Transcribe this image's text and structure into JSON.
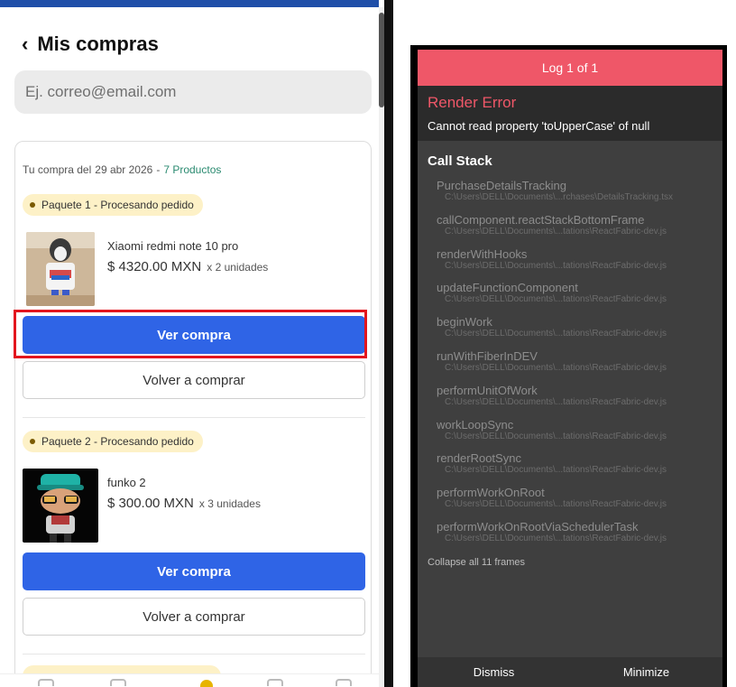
{
  "app": {
    "title": "Mis compras",
    "search_placeholder": "Ej. correo@email.com",
    "purchase": {
      "prefix": "Tu compra del",
      "date": "29 abr 2026",
      "sep": "-",
      "count": "7 Productos"
    },
    "packages": [
      {
        "badge": "Paquete 1 - Procesando pedido",
        "product_name": "Xiaomi redmi note 10 pro",
        "price": "$ 4320.00 MXN",
        "qty": "x 2 unidades",
        "btn_primary": "Ver compra",
        "btn_secondary": "Volver a comprar"
      },
      {
        "badge": "Paquete 2 - Procesando pedido",
        "product_name": "funko 2",
        "price": "$ 300.00 MXN",
        "qty": "x 3 unidades",
        "btn_primary": "Ver compra",
        "btn_secondary": "Volver a comprar"
      }
    ],
    "colors": {
      "primary": "#2f64e6",
      "badge_bg": "#fdf1c7",
      "highlight": "#e3161e",
      "count": "#2a8a70"
    }
  },
  "log": {
    "header": "Log 1 of 1",
    "error_title": "Render Error",
    "error_message": "Cannot read property 'toUpperCase' of null",
    "stack_title": "Call Stack",
    "frames": [
      {
        "fn": "PurchaseDetailsTracking",
        "file": "C:\\Users\\DELL\\Documents\\...rchases\\DetailsTracking.tsx"
      },
      {
        "fn": "callComponent.reactStackBottomFrame",
        "file": "C:\\Users\\DELL\\Documents\\...tations\\ReactFabric-dev.js"
      },
      {
        "fn": "renderWithHooks",
        "file": "C:\\Users\\DELL\\Documents\\...tations\\ReactFabric-dev.js"
      },
      {
        "fn": "updateFunctionComponent",
        "file": "C:\\Users\\DELL\\Documents\\...tations\\ReactFabric-dev.js"
      },
      {
        "fn": "beginWork",
        "file": "C:\\Users\\DELL\\Documents\\...tations\\ReactFabric-dev.js"
      },
      {
        "fn": "runWithFiberInDEV",
        "file": "C:\\Users\\DELL\\Documents\\...tations\\ReactFabric-dev.js"
      },
      {
        "fn": "performUnitOfWork",
        "file": "C:\\Users\\DELL\\Documents\\...tations\\ReactFabric-dev.js"
      },
      {
        "fn": "workLoopSync",
        "file": "C:\\Users\\DELL\\Documents\\...tations\\ReactFabric-dev.js"
      },
      {
        "fn": "renderRootSync",
        "file": "C:\\Users\\DELL\\Documents\\...tations\\ReactFabric-dev.js"
      },
      {
        "fn": "performWorkOnRoot",
        "file": "C:\\Users\\DELL\\Documents\\...tations\\ReactFabric-dev.js"
      },
      {
        "fn": "performWorkOnRootViaSchedulerTask",
        "file": "C:\\Users\\DELL\\Documents\\...tations\\ReactFabric-dev.js"
      }
    ],
    "collapse_label": "Collapse all 11 frames",
    "dismiss_label": "Dismiss",
    "minimize_label": "Minimize",
    "colors": {
      "header_bg": "#ef5768",
      "error_title": "#ef5768"
    }
  }
}
